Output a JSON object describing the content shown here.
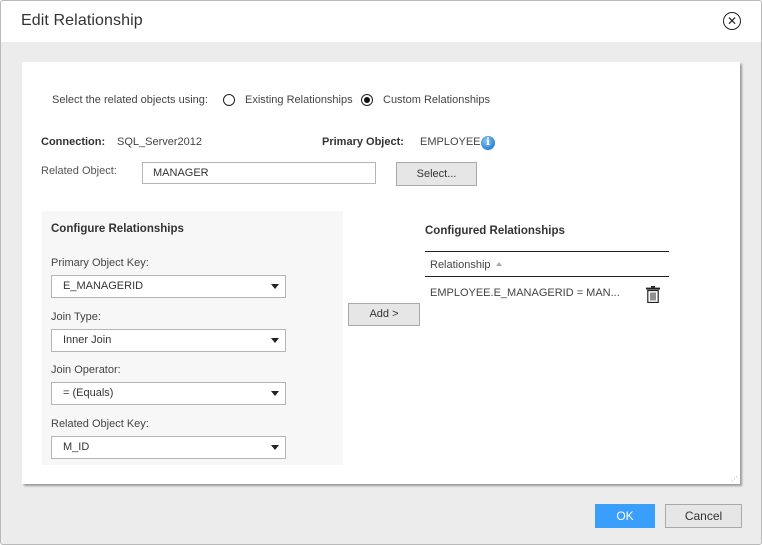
{
  "dialog": {
    "title": "Edit Relationship",
    "close_icon": "close-circle-icon"
  },
  "selection": {
    "label": "Select the related objects using:",
    "options": [
      {
        "label": "Existing Relationships",
        "checked": false
      },
      {
        "label": "Custom Relationships",
        "checked": true
      }
    ]
  },
  "connection": {
    "label": "Connection:",
    "value": "SQL_Server2012"
  },
  "primary_object": {
    "label": "Primary Object:",
    "value": "EMPLOYEE",
    "icon": "info-icon"
  },
  "related_object": {
    "label": "Related Object:",
    "value": "MANAGER",
    "select_button": "Select..."
  },
  "configure": {
    "title": "Configure Relationships",
    "fields": [
      {
        "label": "Primary Object Key:",
        "value": "E_MANAGERID"
      },
      {
        "label": "Join Type:",
        "value": "Inner Join"
      },
      {
        "label": "Join Operator:",
        "value": "= (Equals)"
      },
      {
        "label": "Related Object Key:",
        "value": "M_ID"
      }
    ]
  },
  "add_button": "Add >",
  "configured": {
    "title": "Configured Relationships",
    "column_header": "Relationship",
    "sort": "ascending",
    "rows": [
      {
        "relationship": "EMPLOYEE.E_MANAGERID = MAN...",
        "action_icon": "trash-icon"
      }
    ]
  },
  "footer": {
    "ok": "OK",
    "cancel": "Cancel"
  },
  "colors": {
    "primary_button": "#3a9efc",
    "info_icon": "#2a83d4",
    "dialog_bg": "#ececec"
  }
}
